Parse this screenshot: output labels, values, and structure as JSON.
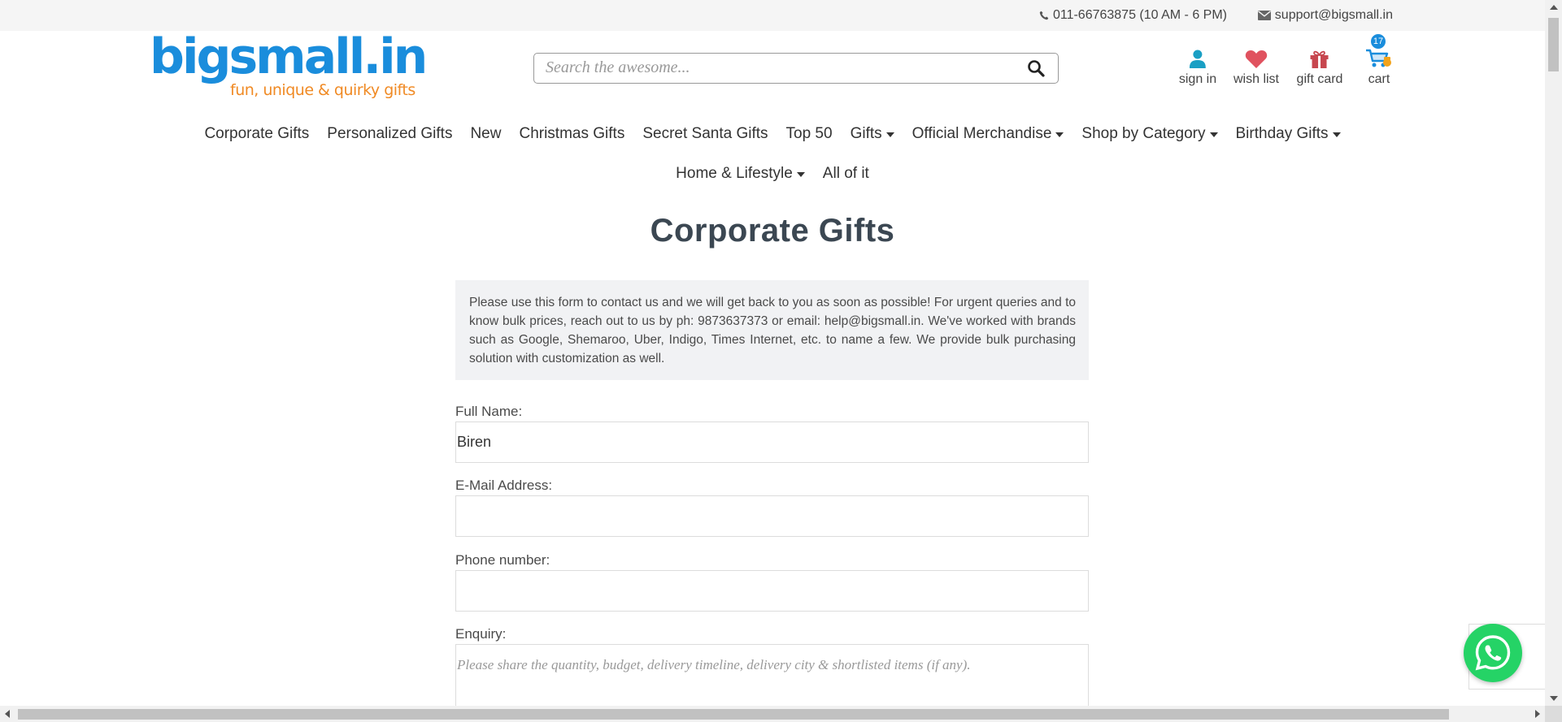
{
  "topbar": {
    "phone_text": "011-66763875 (10 AM - 6 PM)",
    "email_text": "support@bigsmall.in",
    "phone_icon": "phone-icon",
    "email_icon": "envelope-icon"
  },
  "logo": {
    "name": "bigsmall.in",
    "tagline": "fun, unique & quirky gifts"
  },
  "search": {
    "placeholder": "Search the awesome...",
    "icon": "search-icon"
  },
  "user_links": {
    "sign_in": "sign in",
    "wish_list": "wish list",
    "gift_card": "gift card",
    "cart": "cart",
    "cart_count": "17"
  },
  "nav": {
    "row1": [
      {
        "label": "Corporate Gifts",
        "dropdown": false
      },
      {
        "label": "Personalized Gifts",
        "dropdown": false
      },
      {
        "label": "New",
        "dropdown": false
      },
      {
        "label": "Christmas Gifts",
        "dropdown": false
      },
      {
        "label": "Secret Santa Gifts",
        "dropdown": false
      },
      {
        "label": "Top 50",
        "dropdown": false
      },
      {
        "label": "Gifts",
        "dropdown": true
      },
      {
        "label": "Official Merchandise",
        "dropdown": true
      },
      {
        "label": "Shop by Category",
        "dropdown": true
      },
      {
        "label": "Birthday Gifts",
        "dropdown": true
      }
    ],
    "row2": [
      {
        "label": "Home & Lifestyle",
        "dropdown": true
      },
      {
        "label": "All of it",
        "dropdown": false
      }
    ]
  },
  "page": {
    "title": "Corporate Gifts",
    "info_text": "Please use this form to contact us and we will get back to you as soon as possible! For urgent queries and to know bulk prices, reach out to us by ph: 9873637373 or email: help@bigsmall.in. We've worked with brands such as Google, Shemaroo, Uber, Indigo, Times Internet, etc. to name a few. We provide bulk purchasing solution with customization as well."
  },
  "form": {
    "full_name_label": "Full Name:",
    "full_name_value": "Biren",
    "email_label": "E-Mail Address:",
    "email_value": "",
    "phone_label": "Phone number:",
    "phone_value": "",
    "enquiry_label": "Enquiry:",
    "enquiry_placeholder": "Please share the quantity, budget, delivery timeline, delivery city & shortlisted items (if any)."
  },
  "colors": {
    "brand_blue": "#1a8ddc",
    "brand_orange": "#f08a24",
    "whatsapp_green": "#25d366",
    "wish_red": "#e0525f",
    "gift_red": "#c7474f"
  }
}
